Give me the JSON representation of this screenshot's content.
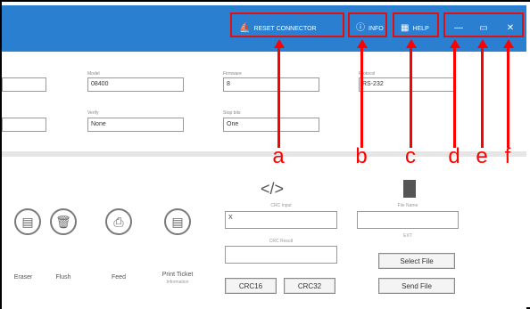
{
  "titlebar": {
    "color": "#2a7fd0",
    "buttons": [
      {
        "label": "RESET CONNECTOR",
        "icon": "plug-icon"
      },
      {
        "label": "INFO",
        "icon": "info-icon"
      },
      {
        "label": "HELP",
        "icon": "help-book-icon"
      },
      {
        "label": "",
        "icon": "minimize-icon"
      },
      {
        "label": "",
        "icon": "maximize-icon"
      },
      {
        "label": "",
        "icon": "close-icon"
      }
    ]
  },
  "info": {
    "fields": [
      {
        "label": "Model",
        "value": "08400"
      },
      {
        "label": "Firmware",
        "value": "8"
      },
      {
        "label": "Protocol",
        "value": "RS-232"
      },
      {
        "label": "Verify",
        "value": "None"
      },
      {
        "label": "Stop bits",
        "value": "One"
      },
      {
        "left_value_top": "",
        "left_value_bottom": ""
      }
    ]
  },
  "lower": {
    "code_icon_glyph": "</>",
    "actions": [
      {
        "label": "Eraser"
      },
      {
        "label": "Flush"
      },
      {
        "label": "Feed"
      },
      {
        "label": "Print Ticket",
        "sublabel": "Information"
      }
    ],
    "crc": {
      "input_label": "CRC Input",
      "input_value": "X",
      "output_label": "CRC Result",
      "output_value": "",
      "crc16": "CRC16",
      "crc32": "CRC32"
    },
    "file": {
      "name_label": "File Name",
      "name_value": "",
      "ext_label": "EXT",
      "select": "Select File",
      "send": "Send File"
    }
  },
  "annotations": {
    "color": "#ff0000",
    "letters": [
      "a",
      "b",
      "c",
      "d",
      "e",
      "f"
    ]
  }
}
